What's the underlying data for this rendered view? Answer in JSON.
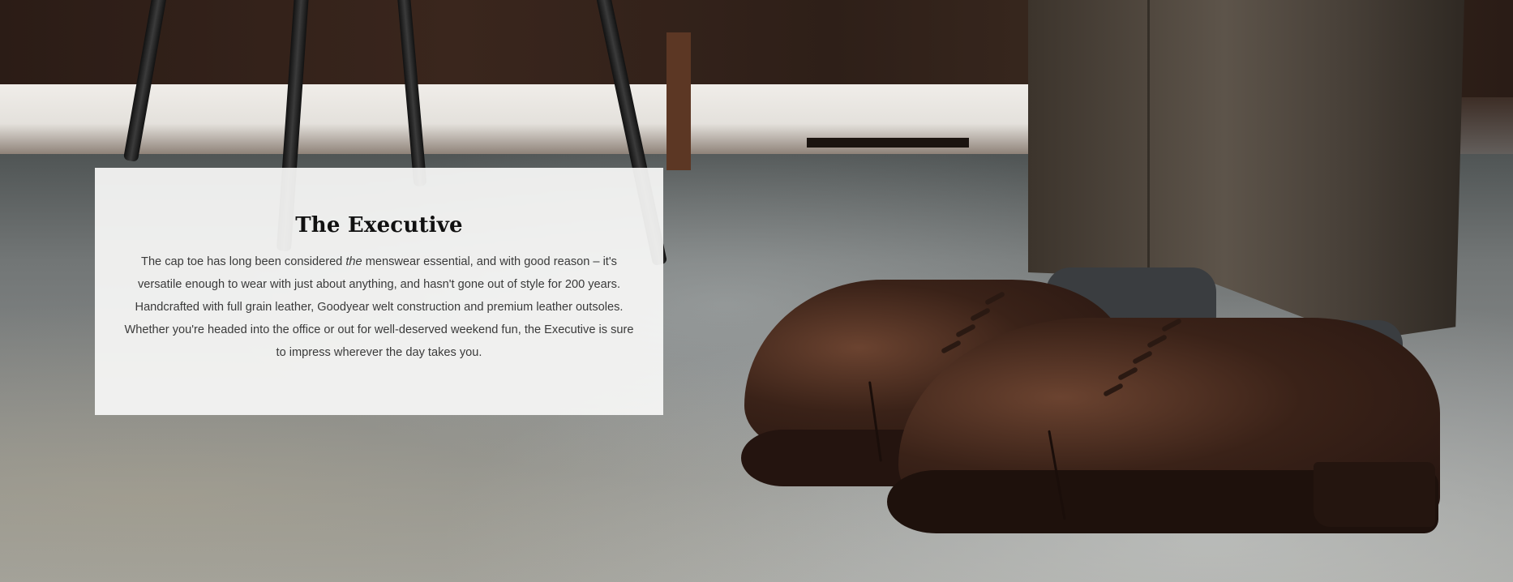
{
  "hero": {
    "title": "The Executive",
    "description_before": "The cap toe has long been considered ",
    "description_emphasis": "the",
    "description_after": " menswear essential, and with good reason – it's versatile enough to wear with just about anything, and hasn't gone out of style for 200 years. Handcrafted with full grain leather, Goodyear welt construction and premium leather outsoles. Whether you're headed into the office or out for well-deserved weekend fun, the Executive is sure to impress wherever the day takes you."
  },
  "colors": {
    "card_background": "#f7f7f6",
    "title": "#111111",
    "body_text": "#3a3a3a",
    "leather": "#3a2218"
  }
}
